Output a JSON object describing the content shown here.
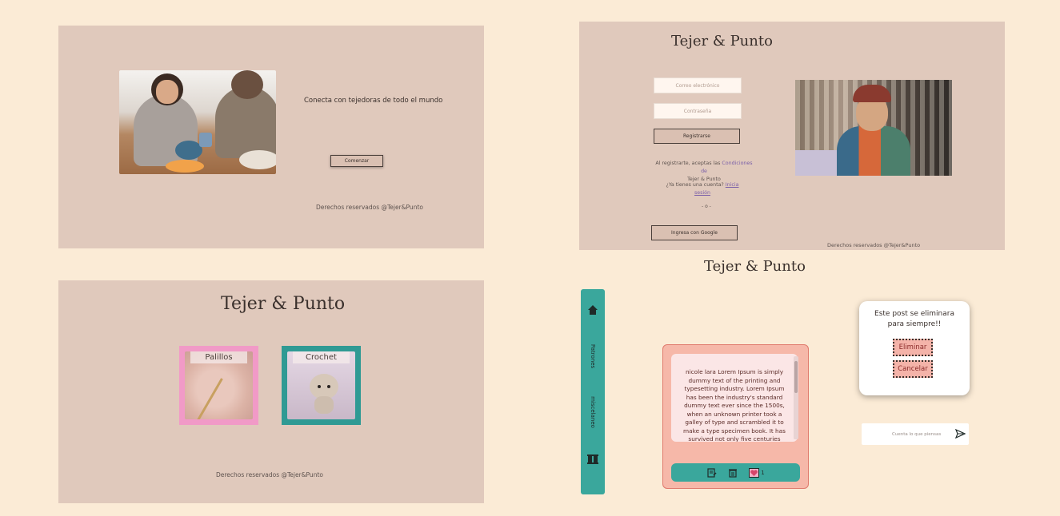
{
  "brand": "Tejer & Punto",
  "landing": {
    "tagline": "Conecta con tejedoras de todo el mundo",
    "start_button": "Comenzar",
    "footer": "Derechos reservados @Tejer&Punto"
  },
  "register": {
    "brand": "Tejer & Punto",
    "email_placeholder": "Correo electrónico",
    "password_placeholder": "Contraseña",
    "register_button": "Registrarse",
    "terms_prefix": "Al registrarte, aceptas las",
    "terms_link": "Condiciones de",
    "terms_suffix": "Tejer & Punto",
    "account_prefix": "¿Ya tienes una cuenta?",
    "login_link_1": "Inicia",
    "login_link_2": "sesión",
    "separator": "- o -",
    "google_button": "Ingresa con Google",
    "footer": "Derechos reservados @Tejer&Punto"
  },
  "categories": {
    "brand": "Tejer & Punto",
    "items": [
      {
        "label": "Palillos",
        "color": "#f19ac7"
      },
      {
        "label": "Crochet",
        "color": "#2f9a94"
      }
    ],
    "footer": "Derechos reservados @Tejer&Punto"
  },
  "feed": {
    "brand": "Tejer & Punto",
    "sidebar": {
      "icons": [
        "home-icon",
        "spool-icon"
      ],
      "labels": [
        "Patrones",
        "miscelaneo"
      ]
    },
    "post": {
      "text": "nicole lara Lorem Ipsum is simply dummy text of the printing and typesetting industry. Lorem Ipsum has been the industry's standard dummy text ever since the 1500s, when an unknown printer took a galley of type and scrambled it to make a type specimen book. It has survived not only five centuries",
      "likes": "1"
    },
    "delete_modal": {
      "message": "Este post se eliminara para siempre!!",
      "confirm": "Eliminar",
      "cancel": "Cancelar"
    },
    "comment_placeholder": "Cuenta lo que piensas"
  },
  "colors": {
    "background": "#fbebd6",
    "panel": "#e0c9bc",
    "teal": "#3aa79c",
    "pink": "#f19ac7",
    "salmon": "#f6b8a9"
  }
}
